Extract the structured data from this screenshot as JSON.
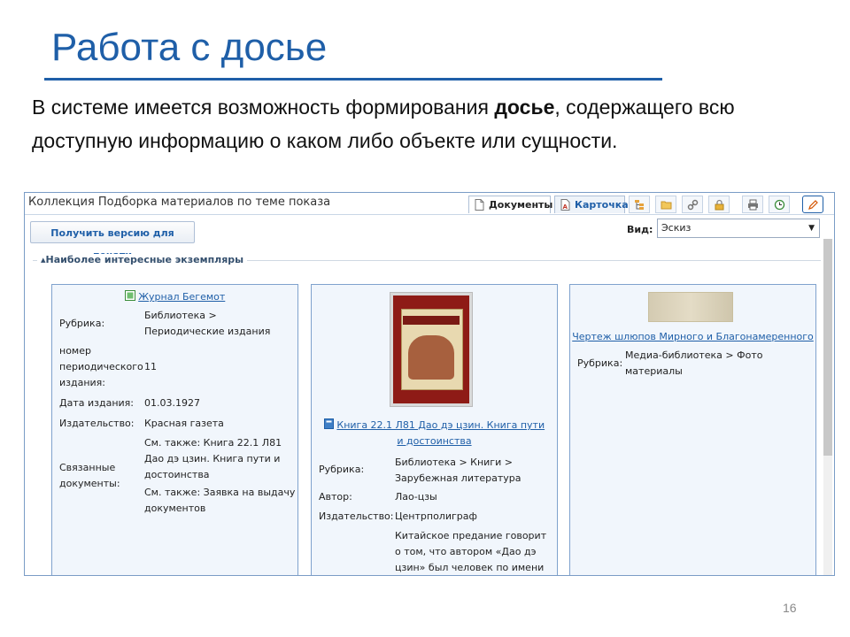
{
  "slide": {
    "title": "Работа с досье",
    "intro_before": "В системе имеется возможность формирования ",
    "intro_bold": "досье",
    "intro_after": ", содержащего всю доступную информацию о каком либо объекте или сущности.",
    "page_number": "16"
  },
  "app": {
    "collection_title": "Коллекция Подборка материалов по теме показа",
    "tabs": [
      {
        "label": "Документы",
        "icon": "document-icon",
        "active": true
      },
      {
        "label": "Карточка",
        "icon": "card-icon",
        "active": false
      }
    ],
    "toolbar_icons": [
      "tree-icon",
      "folder-icon",
      "link-icon",
      "lock-icon",
      "print-icon",
      "history-icon",
      "edit-icon"
    ],
    "print_button": "Получить версию для печати",
    "view_label": "Вид:",
    "view_value": "Эскиз",
    "group_title": "Наиболее интересные экземпляры",
    "colors": {
      "accent": "#1f5fa8",
      "card_bg": "#f1f6fc",
      "card_border": "#7fa2cd"
    }
  },
  "cards": [
    {
      "title": "Журнал Бегемот",
      "icon": "journal-icon",
      "fields": [
        {
          "label": "Рубрика:",
          "value": "Библиотека > Периодические издания"
        },
        {
          "label": "номер периодического издания:",
          "value": "11"
        },
        {
          "label": "Дата издания:",
          "value": "01.03.1927"
        },
        {
          "label": "Издательство:",
          "value": "Красная газета"
        },
        {
          "label": "Связанные документы:",
          "value": "См. также: Книга 22.1 Л81 Дао дэ цзин. Книга пути и достоинства",
          "value2": "См. также: Заявка на выдачу документов"
        }
      ]
    },
    {
      "title": "Книга 22.1 Л81 Дао дэ цзин. Книга пути и достоинства",
      "icon": "book-icon",
      "fields": [
        {
          "label": "Рубрика:",
          "value": "Библиотека > Книги > Зарубежная литература"
        },
        {
          "label": "Автор:",
          "value": "Лао-цзы"
        },
        {
          "label": "Издательство:",
          "value": "Центрполиграф"
        },
        {
          "label": "",
          "value": "Китайское предание говорит о том, что автором «Дао дэ цзин» был человек по имени"
        }
      ]
    },
    {
      "title": "Чертеж шлюпов Мирного и Благонамеренного",
      "fields": [
        {
          "label": "Рубрика:",
          "value": "Медиа-библиотека > Фото материалы"
        }
      ]
    }
  ]
}
